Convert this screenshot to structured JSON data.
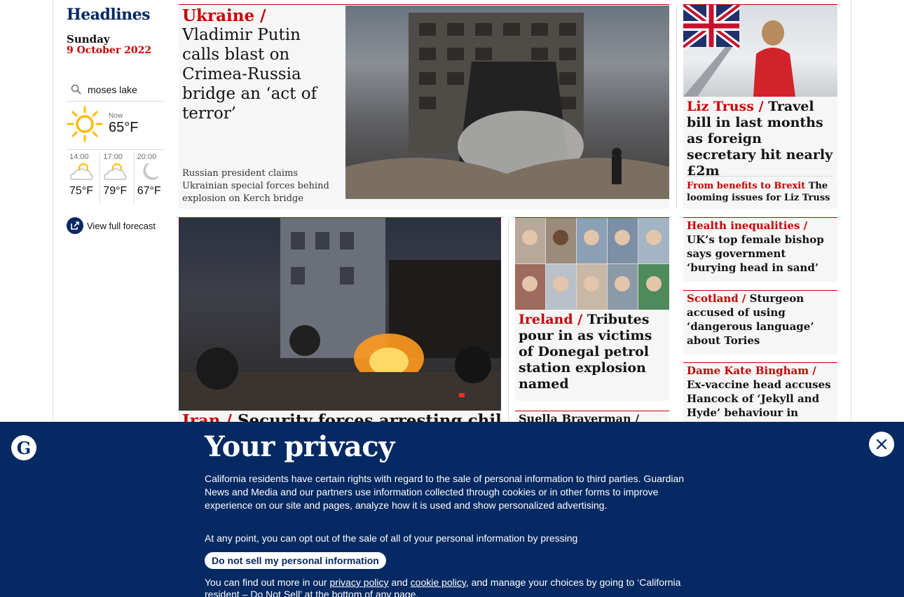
{
  "sidebar": {
    "title": "Headlines",
    "day": "Sunday",
    "date": "9 October 2022"
  },
  "weather": {
    "location": "moses lake",
    "now_label": "Now",
    "now_temp": "65°F",
    "hours": [
      {
        "time": "14:00",
        "temp": "75°F",
        "icon": "partly-sunny-icon"
      },
      {
        "time": "17:00",
        "temp": "79°F",
        "icon": "partly-sunny-icon"
      },
      {
        "time": "20:00",
        "temp": "67°F",
        "icon": "moon-icon"
      }
    ],
    "forecast_link": "View full forecast"
  },
  "stories": {
    "ukraine": {
      "kicker": "Ukraine /",
      "headline": "Vladimir Putin calls blast on Crimea-Russia bridge an ‘act of terror’",
      "standfirst": "Russian president claims Ukrainian special forces behind explosion on Kerch bridge"
    },
    "truss": {
      "kicker": "Liz Truss /",
      "headline": "Travel bill in last months as foreign secretary hit nearly £2m",
      "sub_kicker": "From benefits to Brexit",
      "sub_headline": "The looming issues for Liz Truss"
    },
    "iran": {
      "kicker": "Iran /",
      "headline": "Security forces arresting children"
    },
    "ireland": {
      "kicker": "Ireland /",
      "headline": "Tributes pour in as victims of Donegal petrol station explosion named"
    },
    "braverman": {
      "kicker": "Suella Braverman /"
    },
    "health": {
      "kicker": "Health inequalities /",
      "headline": "UK’s top female bishop says government ‘burying head in sand’"
    },
    "scotland": {
      "kicker": "Scotland /",
      "headline": "Sturgeon accused of using ‘dangerous language’ about Tories"
    },
    "bingham": {
      "kicker": "Dame Kate Bingham /",
      "headline": "Ex-vaccine head accuses Hancock of ‘Jekyll and Hyde’ behaviour in"
    }
  },
  "privacy": {
    "title": "Your privacy",
    "body": "California residents have certain rights with regard to the sale of personal information to third parties. Guardian News and Media and our partners use information collected through cookies or in other forms to improve experience on our site and pages, analyze how it is used and show personalized advertising.",
    "optout_text": "At any point, you can opt out of the sale of all of your personal information by pressing",
    "button": "Do not sell my personal information",
    "more_prefix": "You can find out more in our",
    "privacy_link": "privacy policy",
    "and": "and",
    "cookie_link": "cookie policy",
    "more_suffix": ", and manage your choices by going to ‘California resident – Do Not Sell’ at the bottom of any page."
  },
  "colors": {
    "brand": "#052962",
    "kicker": "#c70000",
    "card_bg": "#f6f6f6"
  }
}
